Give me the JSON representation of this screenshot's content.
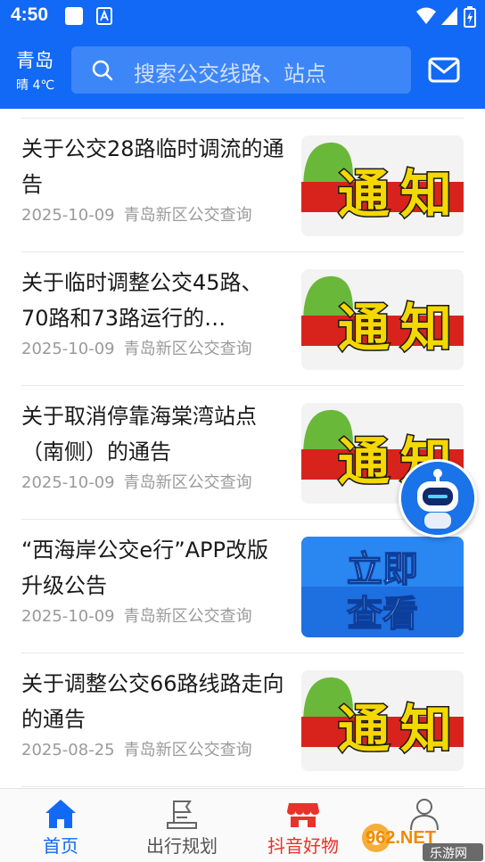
{
  "status_bar": {
    "time": "4:50"
  },
  "header": {
    "city": "青岛",
    "weather": "晴 4℃",
    "search_placeholder": "搜索公交线路、站点"
  },
  "news": [
    {
      "title": "关于公交28路临时调流的通告",
      "date": "2025-10-09",
      "source": "青岛新区公交查询",
      "thumb": "tongzhi"
    },
    {
      "title": "关于临时调整公交45路、70路和73路运行的…",
      "date": "2025-10-09",
      "source": "青岛新区公交查询",
      "thumb": "tongzhi"
    },
    {
      "title": "关于取消停靠海棠湾站点（南侧）的通告",
      "date": "2025-10-09",
      "source": "青岛新区公交查询",
      "thumb": "tongzhi"
    },
    {
      "title": "“西海岸公交e行”APP改版升级公告",
      "date": "2025-10-09",
      "source": "青岛新区公交查询",
      "thumb": "liji"
    },
    {
      "title": "关于调整公交66路线路走向的通告",
      "date": "2025-08-25",
      "source": "青岛新区公交查询",
      "thumb": "tongzhi"
    }
  ],
  "thumb_text": {
    "tongzhi": [
      "通",
      "知"
    ],
    "liji": [
      "立即",
      "查看"
    ]
  },
  "tabs": [
    {
      "label": "首页",
      "icon": "home-icon",
      "state": "active"
    },
    {
      "label": "出行规划",
      "icon": "route-flag-icon",
      "state": "normal"
    },
    {
      "label": "抖音好物",
      "icon": "shop-icon",
      "state": "red"
    },
    {
      "label": "",
      "icon": "profile-icon",
      "state": "normal"
    }
  ],
  "watermark": {
    "brand": "962.NET",
    "site": "乐游网"
  },
  "colors": {
    "brand_blue": "#1269f5",
    "accent_red": "#e8332a",
    "meta_gray": "#9a9a9a"
  }
}
